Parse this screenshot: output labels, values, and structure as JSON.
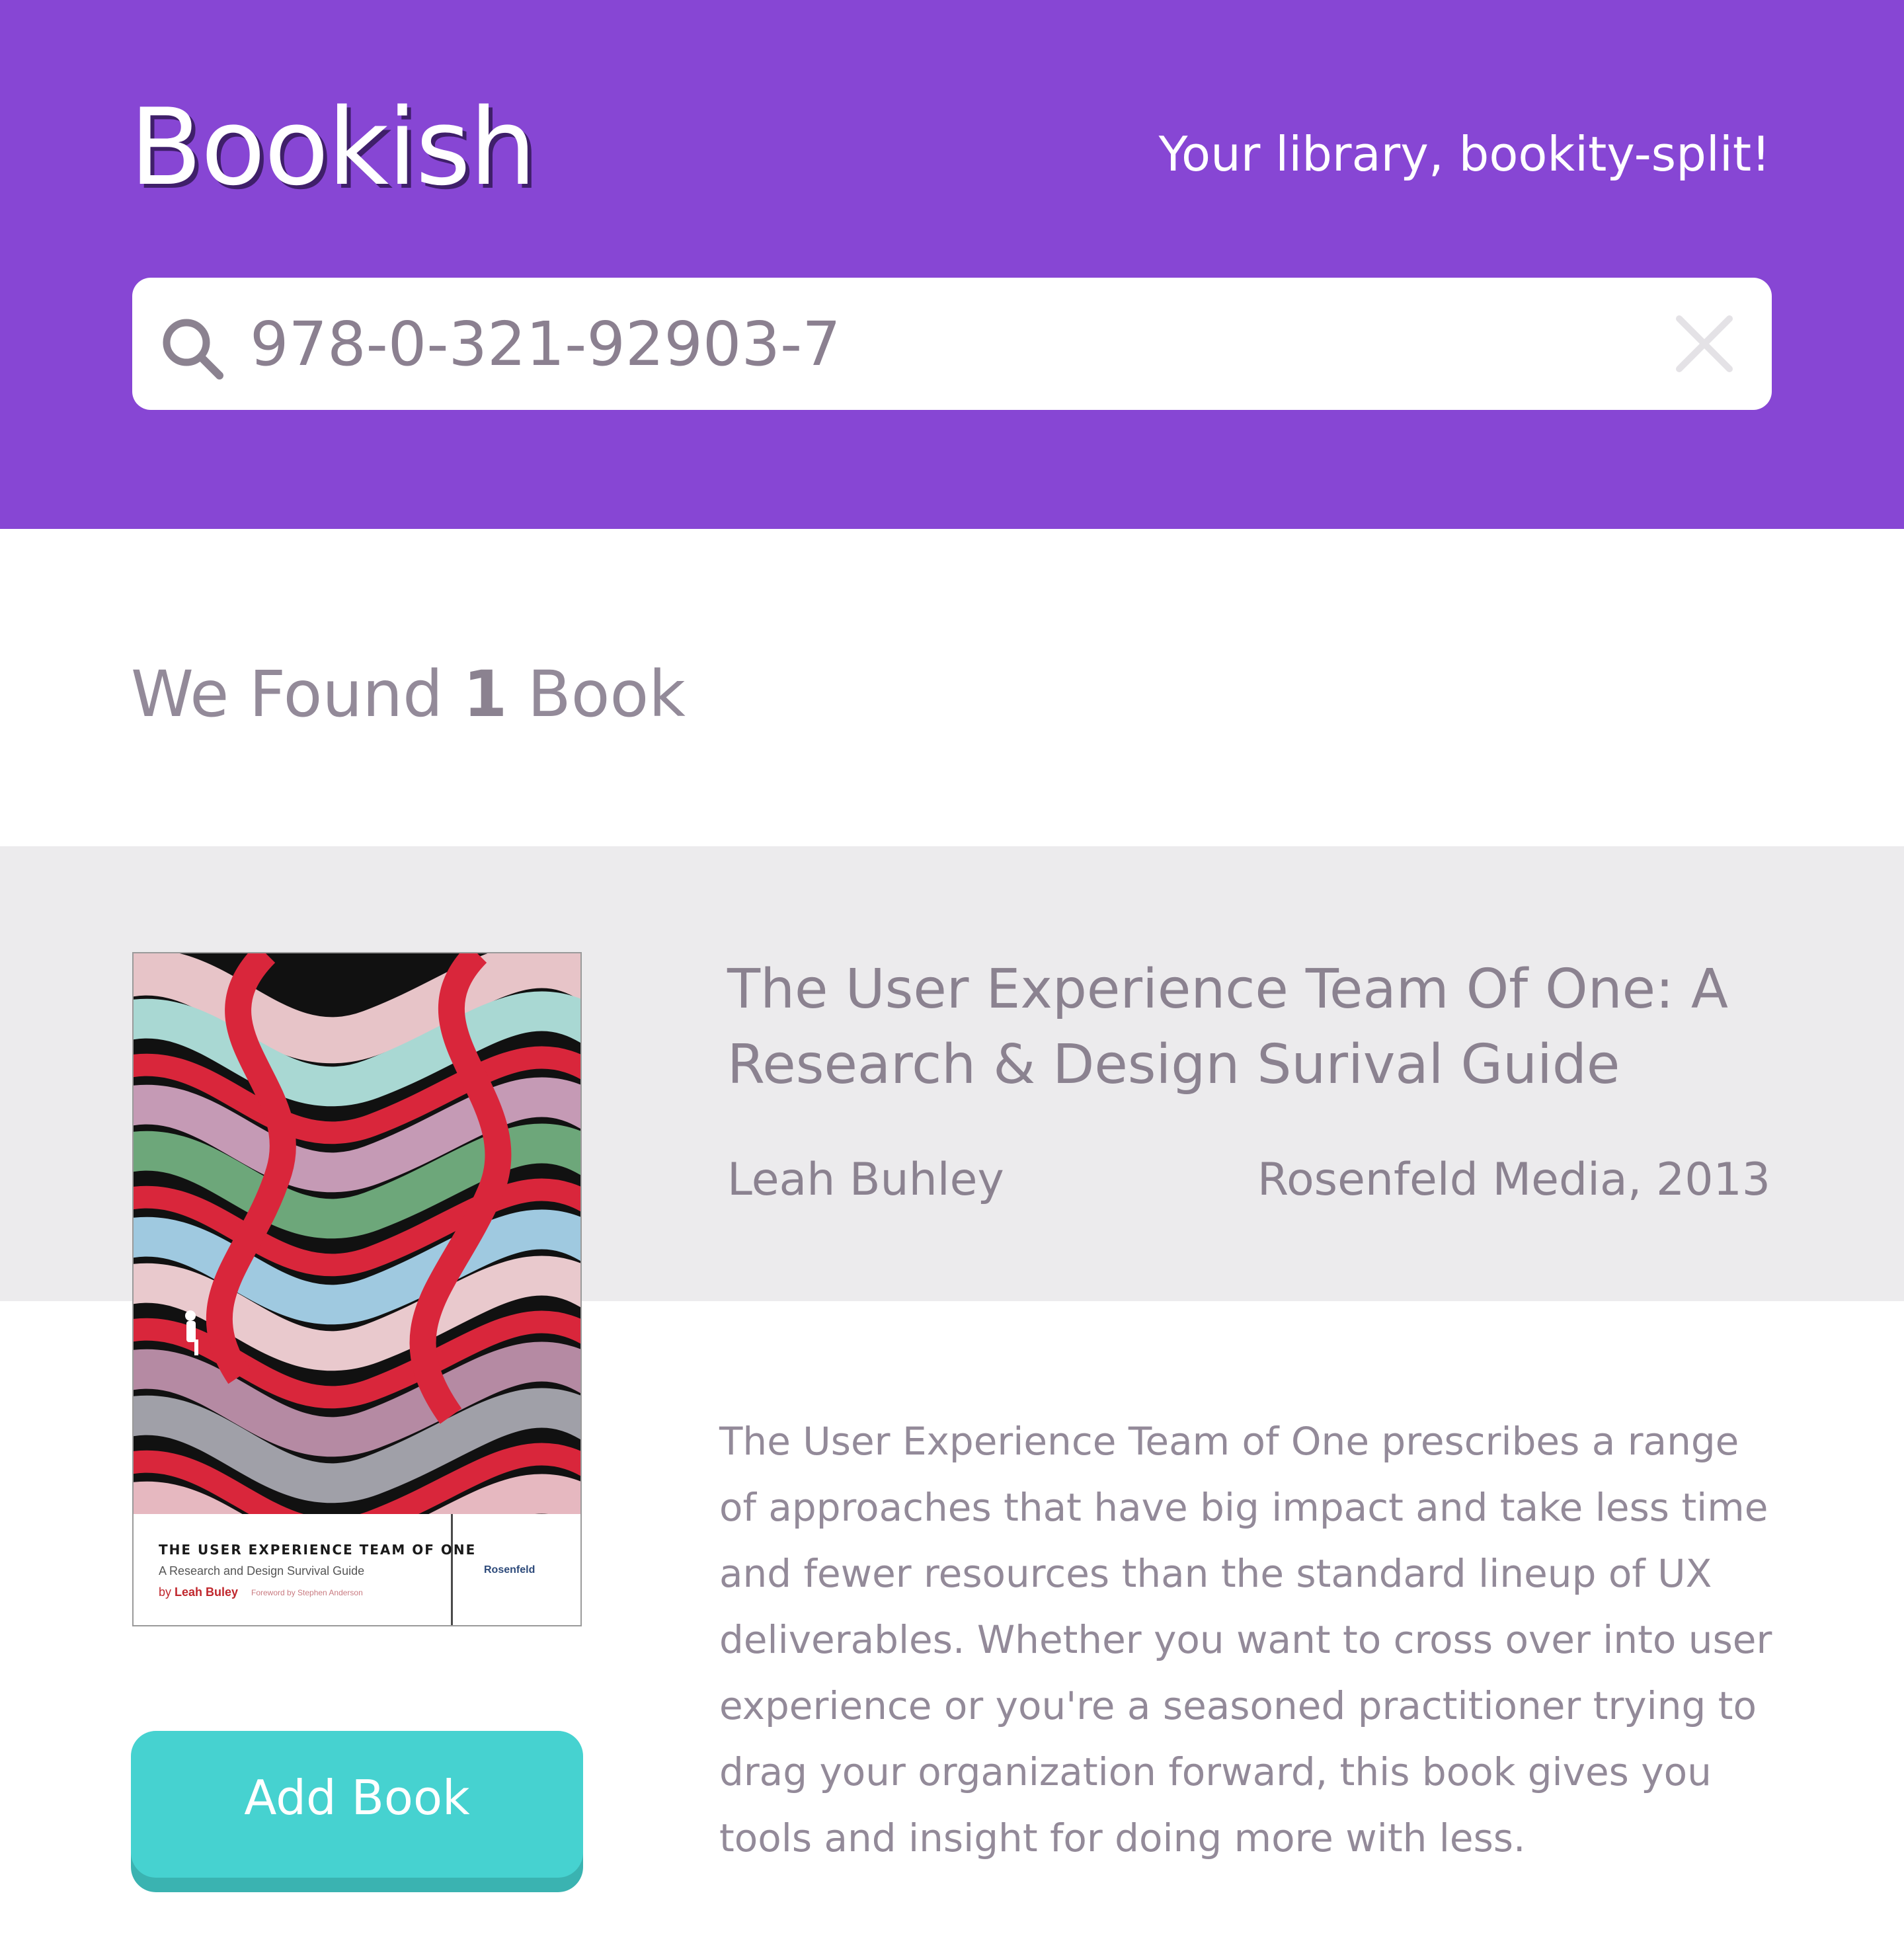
{
  "header": {
    "logo": "Bookish",
    "tagline": "Your library, bookity-split!",
    "brand_color": "#8746d4"
  },
  "search": {
    "value": "978-0-321-92903-7",
    "icon": "search-icon",
    "clear_icon": "close-icon"
  },
  "results": {
    "prefix": "We Found",
    "count": "1",
    "suffix": "Book"
  },
  "book": {
    "title": "The User Experience Team Of One: A Research & Design Surival Guide",
    "author": "Leah Buhley",
    "publisher": "Rosenfeld Media, 2013",
    "description": "The User Experience Team of One prescribes a range of approaches that have big impact and take less time and fewer resources than the standard lineup of UX deliverables. Whether you want to cross over into user experience or you're a seasoned practitioner trying to drag your organization forward, this book gives you tools and insight for doing more with less.",
    "cover": {
      "title": "THE USER EXPERIENCE TEAM OF ONE",
      "subtitle": "A Research and Design Survival Guide",
      "author_prefix": "by",
      "author": "Leah Buley",
      "foreword": "Foreword by Stephen Anderson",
      "publisher": "Rosenfeld"
    },
    "add_button_label": "Add Book",
    "button_color": "#46d2d0"
  }
}
